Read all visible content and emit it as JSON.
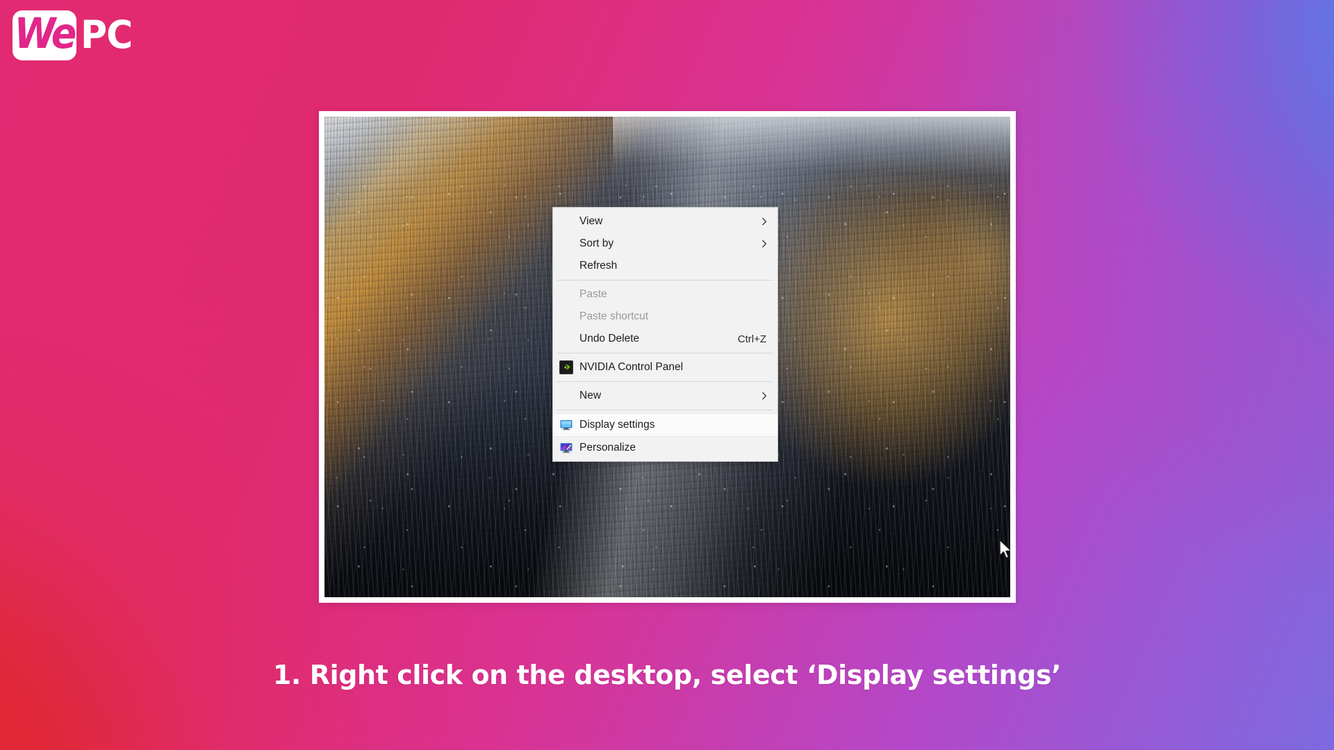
{
  "brand": {
    "mark_text": "We",
    "word_text": "PC",
    "mark_bg": "#ffffff",
    "mark_color": "#e2268a",
    "word_color": "#ffffff"
  },
  "background": {
    "gradient_from": "#e22a72",
    "gradient_mid": "#b448c9",
    "gradient_to": "#4b82ec",
    "gradient_accent_red": "#e0282f"
  },
  "screenshot": {
    "frame_color": "#ffffff",
    "wallpaper_description": "Snowy mountain slope with golden larch forest"
  },
  "context_menu": {
    "background": "#f2f2f2",
    "border": "#c6c6c6",
    "highlight_color": "#fbfbfb",
    "items": [
      {
        "label": "View",
        "accel": "",
        "submenu": true,
        "disabled": false,
        "icon": "",
        "highlight": false
      },
      {
        "label": "Sort by",
        "accel": "",
        "submenu": true,
        "disabled": false,
        "icon": "",
        "highlight": false
      },
      {
        "label": "Refresh",
        "accel": "",
        "submenu": false,
        "disabled": false,
        "icon": "",
        "highlight": false
      },
      {
        "separator": true
      },
      {
        "label": "Paste",
        "accel": "",
        "submenu": false,
        "disabled": true,
        "icon": "",
        "highlight": false
      },
      {
        "label": "Paste shortcut",
        "accel": "",
        "submenu": false,
        "disabled": true,
        "icon": "",
        "highlight": false
      },
      {
        "label": "Undo Delete",
        "accel": "Ctrl+Z",
        "submenu": false,
        "disabled": false,
        "icon": "",
        "highlight": false
      },
      {
        "separator": true
      },
      {
        "label": "NVIDIA Control Panel",
        "accel": "",
        "submenu": false,
        "disabled": false,
        "icon": "nvidia-icon",
        "highlight": false
      },
      {
        "separator": true
      },
      {
        "label": "New",
        "accel": "",
        "submenu": true,
        "disabled": false,
        "icon": "",
        "highlight": false
      },
      {
        "separator": true
      },
      {
        "label": "Display settings",
        "accel": "",
        "submenu": false,
        "disabled": false,
        "icon": "display-icon",
        "highlight": true
      },
      {
        "label": "Personalize",
        "accel": "",
        "submenu": false,
        "disabled": false,
        "icon": "personalize-icon",
        "highlight": false
      }
    ]
  },
  "cursor": {
    "icon": "arrow-pointer-icon"
  },
  "caption": {
    "text": "1. Right click on the desktop, select ‘Display settings’",
    "color": "#ffffff"
  }
}
